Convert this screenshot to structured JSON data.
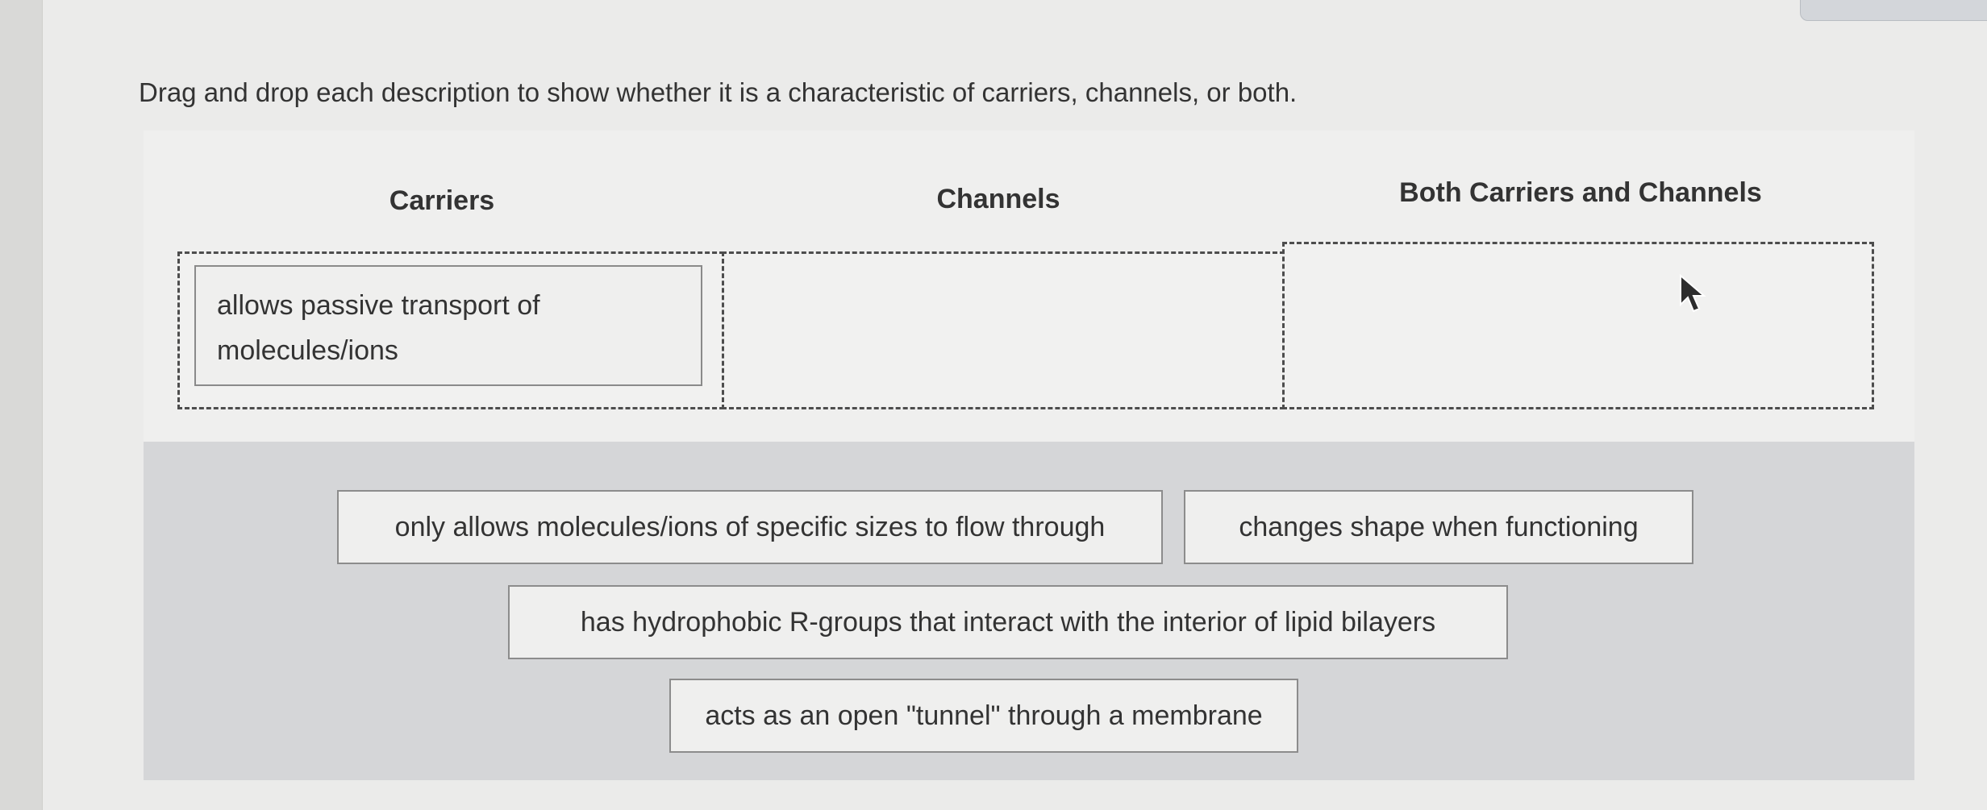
{
  "instructions": "Drag and drop each description to show whether it is a characteristic of carriers, channels, or both.",
  "columns": [
    {
      "label": "Carriers"
    },
    {
      "label": "Channels"
    },
    {
      "label": "Both Carriers and Channels"
    }
  ],
  "placed": {
    "carriers": [
      "allows passive transport of",
      "molecules/ions"
    ]
  },
  "bank_items": [
    "only allows molecules/ions of specific sizes to flow through",
    "changes shape when functioning",
    "has hydrophobic R-groups that interact with the interior of lipid bilayers",
    "acts as an open \"tunnel\" through a membrane"
  ]
}
